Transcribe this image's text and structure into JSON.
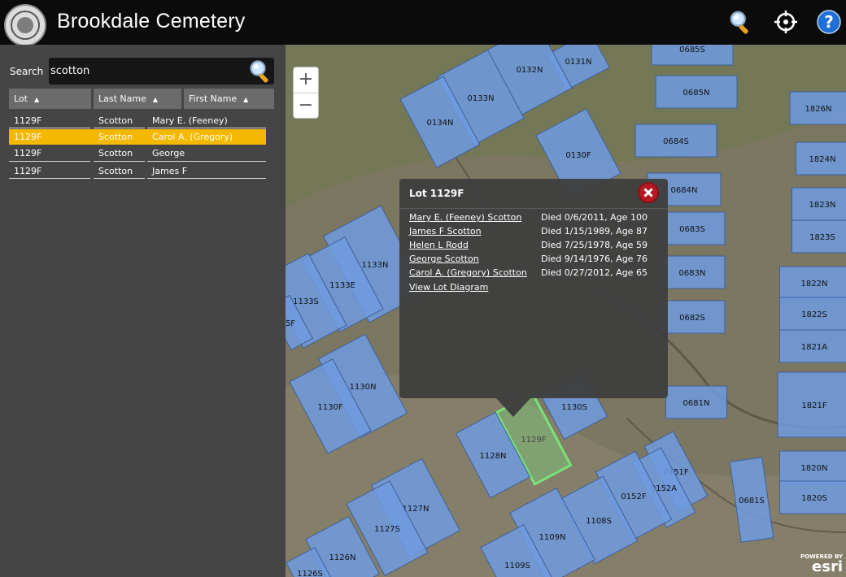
{
  "header": {
    "title": "Brookdale Cemetery",
    "icons": [
      "search-icon",
      "locate-icon",
      "help-icon"
    ]
  },
  "search": {
    "label": "Search",
    "value": "scotton"
  },
  "table": {
    "columns": [
      {
        "label": "Lot",
        "sort": "▲"
      },
      {
        "label": "Last Name",
        "sort": "▲"
      },
      {
        "label": "First Name",
        "sort": "▲"
      }
    ],
    "rows": [
      {
        "lot": "1129F",
        "last": "Scotton",
        "first": "Mary E. (Feeney)",
        "selected": false
      },
      {
        "lot": "1129F",
        "last": "Scotton",
        "first": "Carol A. (Gregory)",
        "selected": true
      },
      {
        "lot": "1129F",
        "last": "Scotton",
        "first": "George",
        "selected": false
      },
      {
        "lot": "1129F",
        "last": "Scotton",
        "first": "James F",
        "selected": false
      }
    ]
  },
  "map": {
    "zoom_in": "+",
    "zoom_out": "−",
    "lots": [
      "0131N",
      "0685S",
      "0132N",
      "0133N",
      "0134N",
      "0685N",
      "1826N",
      "0684S",
      "0130F",
      "1824N",
      "0684N",
      "1823N",
      "0683S",
      "1823S",
      "1133N",
      "1133E",
      "1133S",
      "0683N",
      "1822N",
      "0682S",
      "1822S",
      "1821A",
      "1130N",
      "1130F",
      "0681N",
      "1821F",
      "1130S",
      "1129F",
      "1128N",
      "0151F",
      "0152A",
      "0152F",
      "1820N",
      "1820S",
      "0681S",
      "1127N",
      "1127S",
      "1108S",
      "1109N",
      "1126N",
      "1109S",
      "1126S",
      "5F"
    ],
    "highlight_color": "#79e37a",
    "lot_fill": "#6e9be0"
  },
  "popup": {
    "title": "Lot 1129F",
    "entries": [
      {
        "name": "Mary E. (Feeney) Scotton",
        "died": "Died 0/6/2011, Age 100"
      },
      {
        "name": "James F Scotton",
        "died": "Died 1/15/1989, Age 87"
      },
      {
        "name": "Helen L Rodd",
        "died": "Died 7/25/1978, Age 59"
      },
      {
        "name": "George Scotton",
        "died": "Died 9/14/1976, Age 76"
      },
      {
        "name": "Carol A. (Gregory) Scotton",
        "died": "Died 0/27/2012, Age 65"
      }
    ],
    "link": "View Lot Diagram"
  },
  "attribution": {
    "powered": "POWERED BY",
    "brand": "esri"
  },
  "colors": {
    "selected_row": "#f5b800",
    "close_button": "#b51a22"
  }
}
